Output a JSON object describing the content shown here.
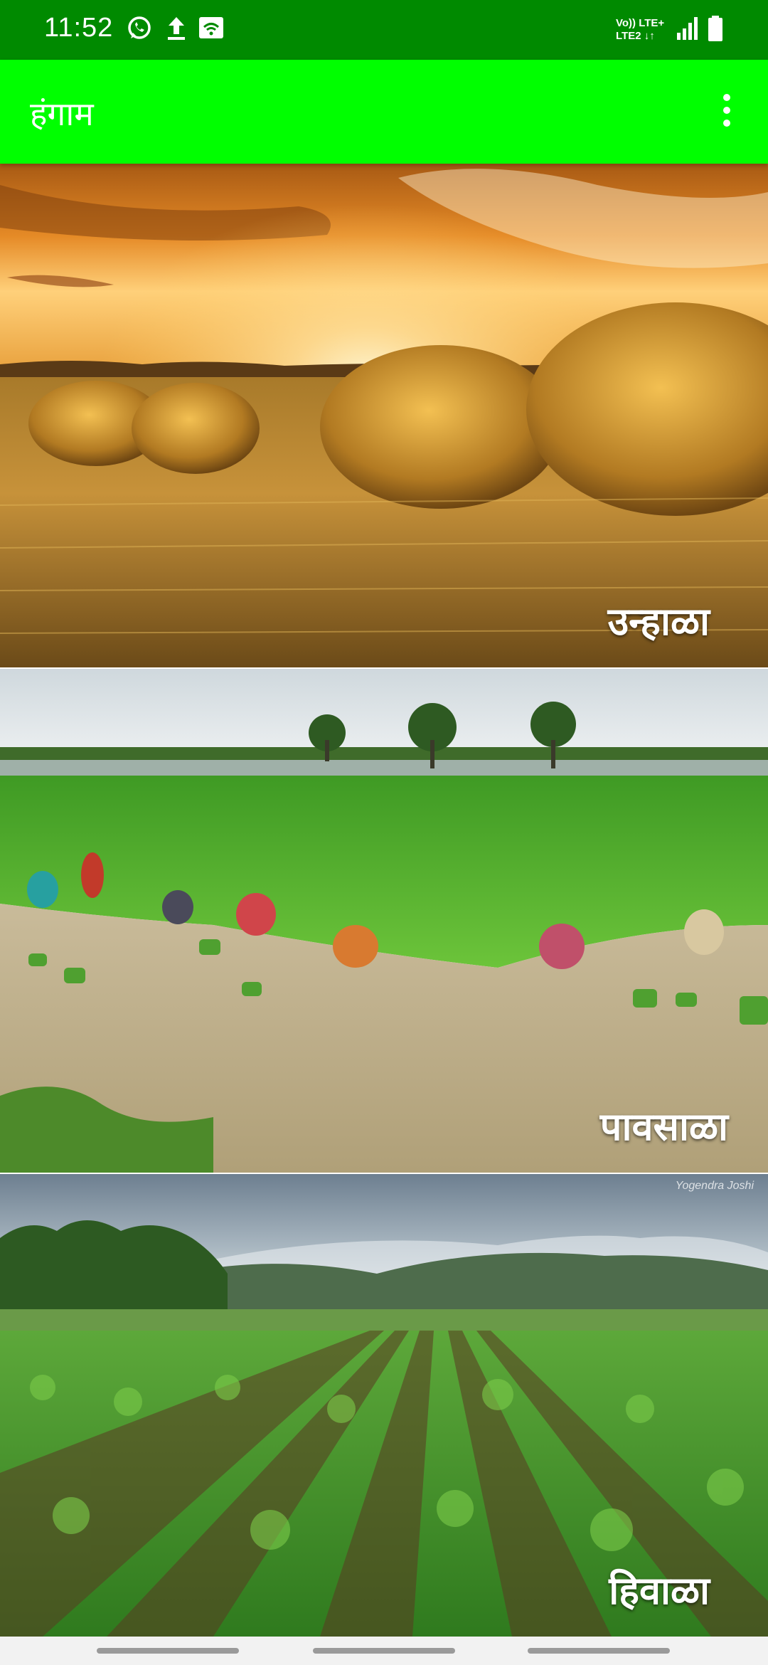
{
  "status_bar": {
    "time": "11:52",
    "left_icons": [
      "whatsapp-icon",
      "upload-icon",
      "wifi-signal-icon"
    ],
    "network_line1": "Vo)) LTE+",
    "network_line2": "LTE2 ↓↑",
    "right_icons": [
      "cell-signal-icon",
      "battery-icon"
    ]
  },
  "app_bar": {
    "title": "हंगाम",
    "menu_icon": "more-vert-icon",
    "color": "#00ff00"
  },
  "seasons": [
    {
      "label": "उन्हाळा",
      "scene": "summer-hay-field-sunset"
    },
    {
      "label": "पावसाळा",
      "scene": "monsoon-rice-planting"
    },
    {
      "label": "हिवाळा",
      "scene": "winter-green-crop-field",
      "watermark": "Yogendra Joshi"
    }
  ],
  "nav_bar": {
    "items": [
      "nav-left",
      "nav-home",
      "nav-right"
    ]
  }
}
